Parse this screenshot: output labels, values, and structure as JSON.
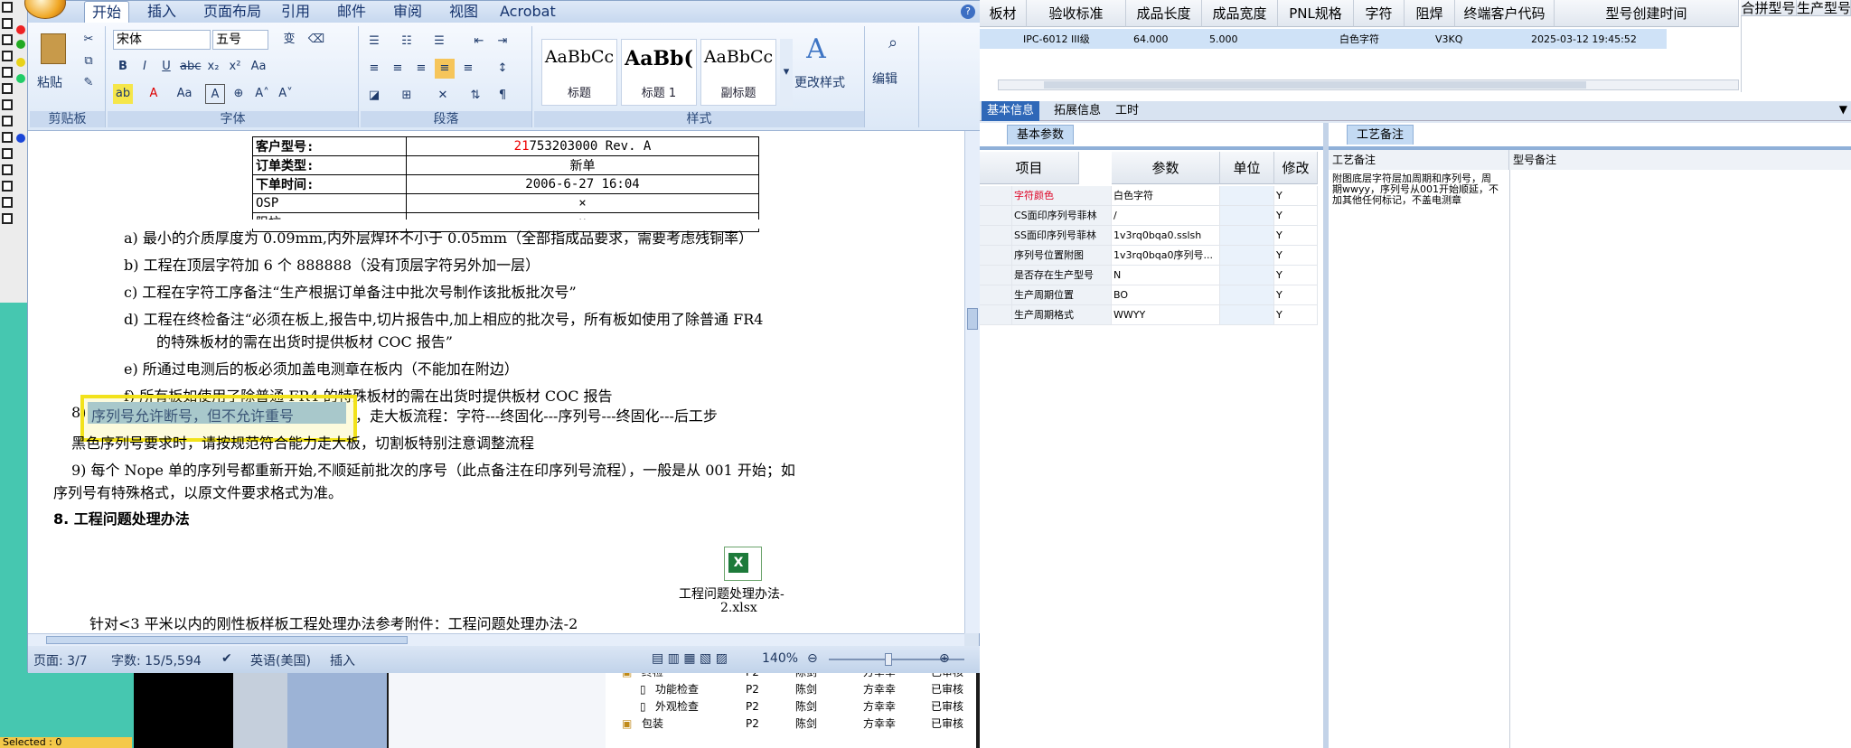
{
  "left_strip": {
    "selected_label": "Selected : 0"
  },
  "word": {
    "tabs": [
      "开始",
      "插入",
      "页面布局",
      "引用",
      "邮件",
      "审阅",
      "视图",
      "Acrobat"
    ],
    "help": "?",
    "ribbon": {
      "clipboard": {
        "paste": "粘贴",
        "label": "剪贴板"
      },
      "font": {
        "name": "宋体",
        "size": "五号",
        "label": "字体",
        "btn_wen": "变",
        "btn_a": "A"
      },
      "paragraph": {
        "label": "段落"
      },
      "styles": {
        "items": [
          {
            "sample": "AaBbCc",
            "name": "标题"
          },
          {
            "sample": "AaBb(",
            "name": "标题 1"
          },
          {
            "sample": "AaBbCc",
            "name": "副标题"
          }
        ],
        "change": "更改样式",
        "label": "样式"
      },
      "editing": {
        "label": "编辑"
      }
    },
    "order_table": [
      [
        "客户型号:",
        "21753203000  Rev. A"
      ],
      [
        "订单类型:",
        "新单"
      ],
      [
        "下单时间:",
        "2006-6-27 16:04"
      ],
      [
        "OSP",
        "×"
      ],
      [
        "阻抗",
        "×"
      ]
    ],
    "lines": {
      "a": "a)   最小的介质厚度为 0.09mm,内外层焊环不小于 0.05mm（全部指成品要求，需要考虑残铜率）",
      "b": "b)   工程在顶层字符加 6 个 888888（没有顶层字符另外加一层）",
      "c": "c)   工程在字符工序备注“生产根据订单备注中批次号制作该批板批次号”",
      "d1": "d)   工程在终检备注“必须在板上,报告中,切片报告中,加上相应的批次号，所有板如使用了除普通  FR4",
      "d2": "的特殊板材的需在出货时提供板材 COC 报告”",
      "e": "e)   所通过电测后的板必须加盖电测章在板内（不能加在附边）",
      "f": "f)   所有板如使用了除普通 FR4 的特殊板材的需在出货时提供板材 COC 报告",
      "eight_num": "8)",
      "eight_hl": "序列号允许断号，但不允许重号",
      "eight_rest": "，走大板流程：字符---终固化---序列号---终固化---后工步",
      "black": "黑色序列号要求时，请按规范符合能力走大板，切割板特别注意调整流程",
      "nine1": "9) 每个 Nope 单的序列号都重新开始,不顺延前批次的序号（此点备注在印序列号流程），一般是从 001 开始；如",
      "nine2": "序列号有特殊格式，以原文件要求格式为准。",
      "heading8": "8.  工程问题处理办法",
      "attach1": "工程问题处理办法-",
      "attach2": "2.xlsx",
      "last": "针对<3 平米以内的刚性板样板工程处理办法参考附件：工程问题处理办法-2"
    },
    "status": {
      "page": "页面: 3/7",
      "words": "字数: 15/5,594",
      "lang": "英语(美国)",
      "mode": "插入",
      "zoom": "140%"
    }
  },
  "tree": [
    {
      "name": "终检",
      "c1": "P2",
      "c2": "陈剑",
      "c3": "方幸幸",
      "c4": "已审核"
    },
    {
      "name": "功能检查",
      "c1": "P2",
      "c2": "陈剑",
      "c3": "方幸幸",
      "c4": "已审核"
    },
    {
      "name": "外观检查",
      "c1": "P2",
      "c2": "陈剑",
      "c3": "方幸幸",
      "c4": "已审核"
    },
    {
      "name": "包装",
      "c1": "P2",
      "c2": "陈剑",
      "c3": "方幸幸",
      "c4": "已审核"
    }
  ],
  "right": {
    "headers": [
      "板材",
      "验收标准",
      "成品长度",
      "成品宽度",
      "PNL规格",
      "字符",
      "阻焊",
      "终端客户代码",
      "型号创建时间",
      "合拼型号",
      "生产型号"
    ],
    "row": {
      "std": "IPC-6012 III级",
      "len": "64.000",
      "wid": "5.000",
      "char": "白色字符",
      "cust": "V3KQ",
      "time": "2025-03-12 19:45:52"
    },
    "tabs": [
      "基本信息",
      "拓展信息",
      "工时"
    ],
    "param_tab": "基本参数",
    "grid_headers": [
      "项目",
      "参数",
      "单位",
      "修改"
    ],
    "grid_rows": [
      {
        "item": "字符颜色",
        "param": "白色字符",
        "mod": "Y"
      },
      {
        "item": "CS面印序列号菲林",
        "param": "/",
        "mod": "Y"
      },
      {
        "item": "SS面印序列号菲林",
        "param": "1v3rq0bqa0.sslsh",
        "mod": "Y"
      },
      {
        "item": "序列号位置附图",
        "param": "1v3rq0bqa0序列号...",
        "mod": "Y"
      },
      {
        "item": "是否存在生产型号",
        "param": "N",
        "mod": "Y"
      },
      {
        "item": "生产周期位置",
        "param": "BO",
        "mod": "Y"
      },
      {
        "item": "生产周期格式",
        "param": "WWYY",
        "mod": "Y"
      }
    ],
    "craft_tab": "工艺备注",
    "craft_header": "工艺备注",
    "model_header": "型号备注",
    "craft_note": "附图底层字符层加周期和序列号，周期wwyy，序列号从001开始顺延，不加其他任何标记，不盖电测章"
  }
}
